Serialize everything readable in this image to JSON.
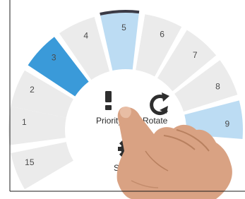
{
  "ring": {
    "segments": [
      {
        "label": "1",
        "state": "default"
      },
      {
        "label": "2",
        "state": "default"
      },
      {
        "label": "3",
        "state": "selected"
      },
      {
        "label": "4",
        "state": "default"
      },
      {
        "label": "5",
        "state": "highlighted"
      },
      {
        "label": "6",
        "state": "default"
      },
      {
        "label": "7",
        "state": "default"
      },
      {
        "label": "8",
        "state": "default"
      },
      {
        "label": "9",
        "state": "highlighted"
      },
      {
        "label": "15",
        "state": "default"
      }
    ]
  },
  "center_menu": {
    "priority": {
      "label": "Priority",
      "icon": "exclamation-icon"
    },
    "rotate": {
      "label": "Rotate",
      "icon": "refresh-icon"
    },
    "settings": {
      "label": "Settings",
      "icon": "gear-icon"
    }
  },
  "colors": {
    "segment_default": "#ebebeb",
    "segment_selected": "#3a9ad9",
    "segment_highlighted": "#bcdcf3",
    "selected_text": "#ffffff",
    "active_marker": "#3a3a45",
    "background": "#ffffff",
    "hand_skin": "#d9a283"
  }
}
